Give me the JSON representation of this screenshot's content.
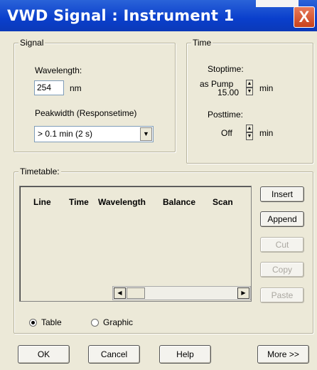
{
  "window": {
    "title": "VWD Signal : Instrument 1",
    "close_glyph": "X"
  },
  "signal": {
    "label": "Signal",
    "wavelength_label": "Wavelength:",
    "wavelength_value": "254",
    "wavelength_unit": "nm",
    "peakwidth_label": "Peakwidth (Responsetime)",
    "peakwidth_value": "> 0.1 min   (2 s)"
  },
  "time": {
    "label": "Time",
    "stoptime_label": "Stoptime:",
    "stoptime_mode": "as Pump",
    "stoptime_value": "15.00",
    "stoptime_unit": "min",
    "posttime_label": "Posttime:",
    "posttime_value": "Off",
    "posttime_unit": "min"
  },
  "timetable": {
    "label": "Timetable:",
    "columns": [
      "Line",
      "Time",
      "Wavelength",
      "Balance",
      "Scan"
    ],
    "buttons": {
      "insert": "Insert",
      "append": "Append",
      "cut": "Cut",
      "copy": "Copy",
      "paste": "Paste"
    },
    "view_options": {
      "table": "Table",
      "graphic": "Graphic",
      "selected": "Table"
    }
  },
  "footer": {
    "ok": "OK",
    "cancel": "Cancel",
    "help": "Help",
    "more": "More >>"
  }
}
